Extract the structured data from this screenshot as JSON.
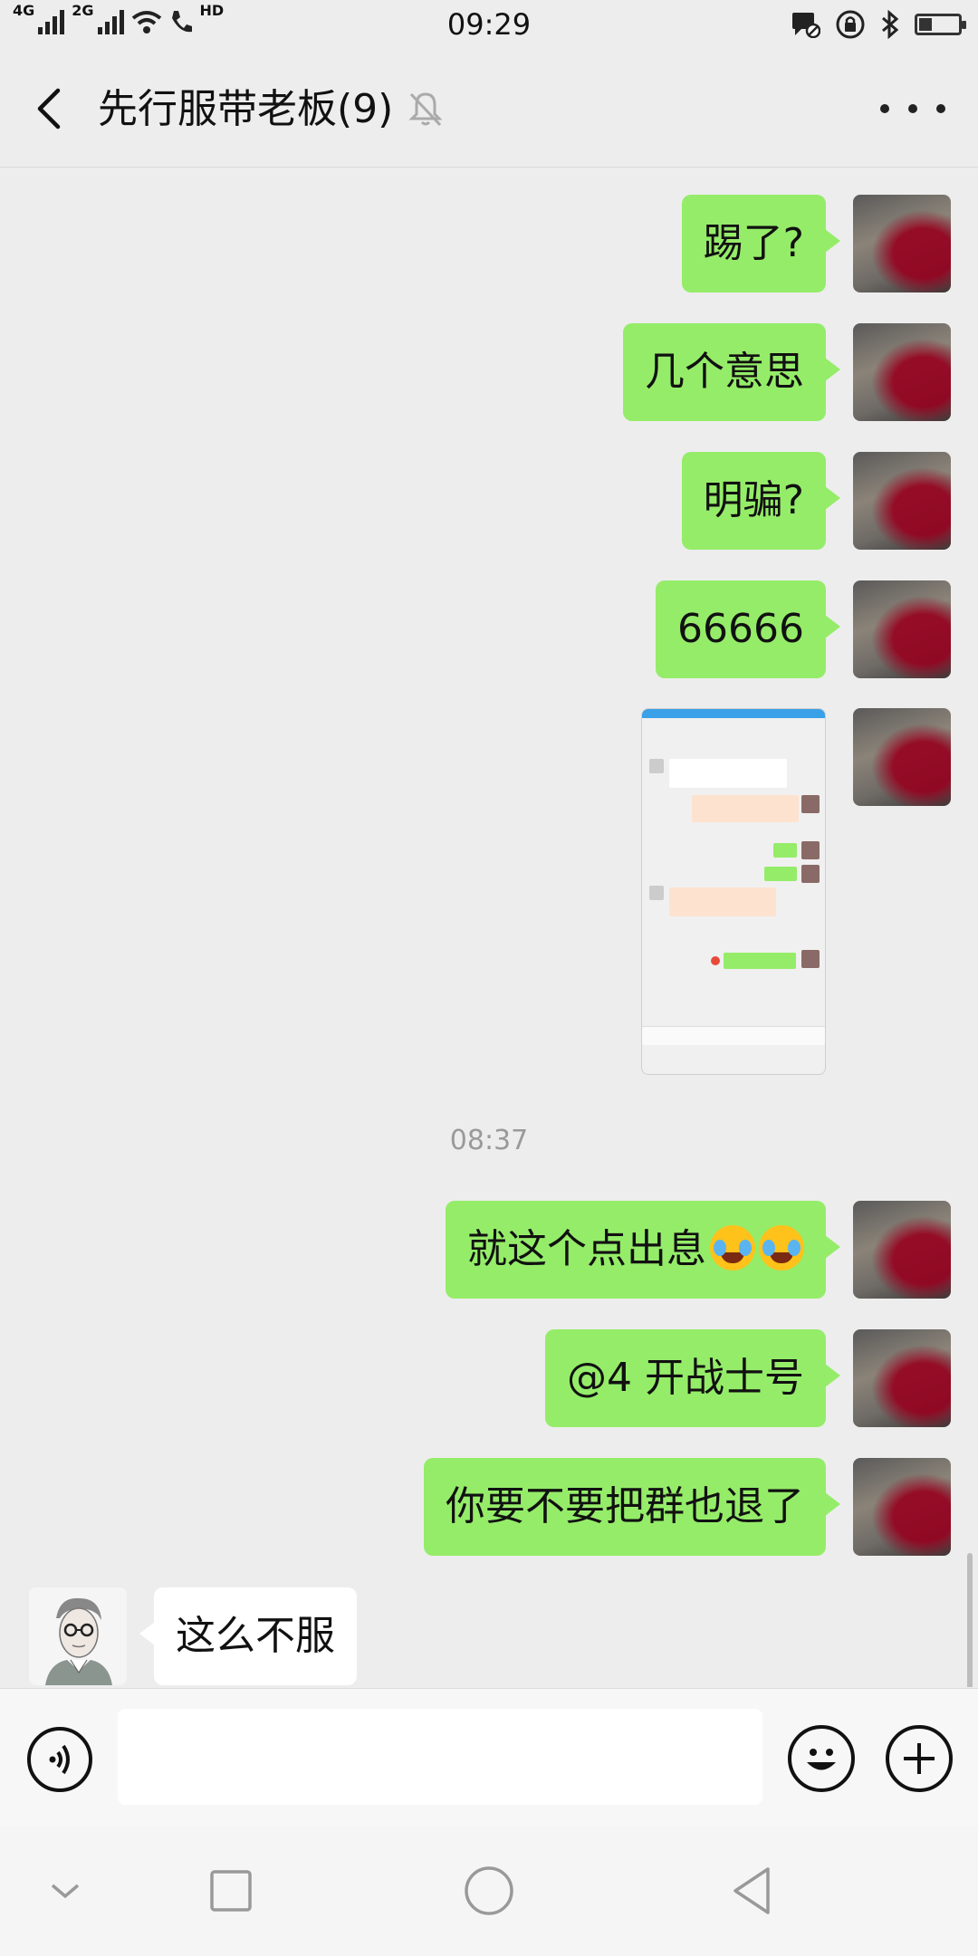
{
  "status": {
    "net1": "4G",
    "net2": "2G",
    "hd": "HD",
    "time": "09:29"
  },
  "header": {
    "title": "先行服带老板(9)"
  },
  "messages": {
    "m1": "踢了?",
    "m2": "几个意思",
    "m3": "明骗?",
    "m4": "66666",
    "time_divider": "08:37",
    "m5": "就这个点出息",
    "m6": "@4 开战士号",
    "m7": "你要不要把群也退了",
    "m8": "这么不服"
  },
  "icons": {
    "back": "chevron-left-icon",
    "mute": "bell-muted-icon",
    "more": "more-dots-icon",
    "voice": "voice-icon",
    "emoji": "smiley-icon",
    "plus": "plus-icon",
    "nav_down": "chevron-down-icon",
    "nav_recent": "square-icon",
    "nav_home": "circle-icon",
    "nav_back": "triangle-back-icon",
    "emoji_in_message": "crying-laughing-emoji"
  },
  "colors": {
    "outgoing_bubble": "#95ec69",
    "incoming_bubble": "#ffffff",
    "background": "#ededed"
  }
}
